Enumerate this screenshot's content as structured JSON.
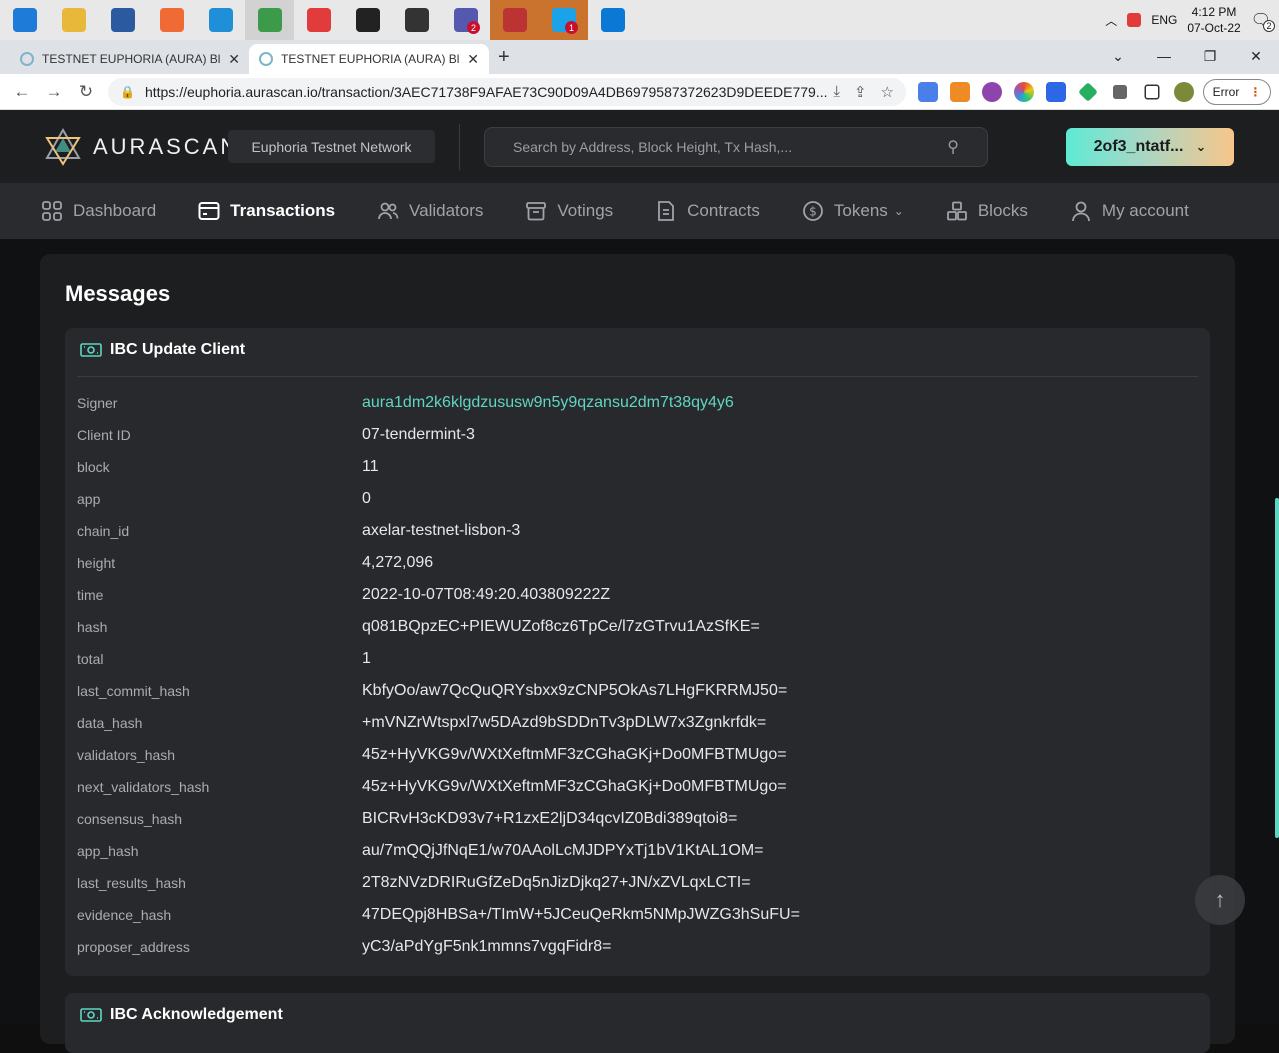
{
  "taskbar": {
    "apps": [
      {
        "name": "windows-start-icon",
        "color": "#1e7bd7"
      },
      {
        "name": "file-explorer-icon",
        "color": "#e8b83b"
      },
      {
        "name": "sql-tool-icon",
        "color": "#2b5aa0"
      },
      {
        "name": "postman-icon",
        "color": "#f06a35"
      },
      {
        "name": "edge-icon",
        "color": "#1f8fd8"
      },
      {
        "name": "chrome-icon",
        "color": "#3c9a4b"
      },
      {
        "name": "paw-icon",
        "color": "#e23b3b"
      },
      {
        "name": "gitkraken-icon",
        "color": "#222222"
      },
      {
        "name": "git-icon",
        "color": "#333333"
      },
      {
        "name": "teams-icon",
        "color": "#5558af",
        "badge": "2"
      },
      {
        "name": "paint-icon",
        "color": "#b33"
      },
      {
        "name": "skype-icon",
        "color": "#1aa3e8",
        "badge": "1"
      },
      {
        "name": "mail-icon",
        "color": "#0a78d4"
      }
    ],
    "tray": {
      "language": "ENG",
      "time": "4:12 PM",
      "date": "07-Oct-22",
      "notifications": "2"
    }
  },
  "browser": {
    "tabs": [
      {
        "title": "TESTNET EUPHORIA (AURA) Bloc"
      },
      {
        "title": "TESTNET EUPHORIA (AURA) Bloc"
      }
    ],
    "url": "https://euphoria.aurascan.io/transaction/3AEC71738F9AFAE73C90D09A4DB6979587372623D9DEEDE779...",
    "error_label": "Error"
  },
  "header": {
    "logo_text": "AURASCAN",
    "network": "Euphoria Testnet Network",
    "search_placeholder": "Search by Address, Block Height, Tx Hash,...",
    "wallet_label": "2of3_ntatf..."
  },
  "nav": [
    {
      "label": "Dashboard",
      "icon": "dashboard-icon"
    },
    {
      "label": "Transactions",
      "icon": "transactions-icon",
      "active": true
    },
    {
      "label": "Validators",
      "icon": "validators-icon"
    },
    {
      "label": "Votings",
      "icon": "votings-icon"
    },
    {
      "label": "Contracts",
      "icon": "contracts-icon"
    },
    {
      "label": "Tokens",
      "icon": "tokens-icon"
    },
    {
      "label": "Blocks",
      "icon": "blocks-icon"
    },
    {
      "label": "My account",
      "icon": "account-icon"
    }
  ],
  "messages": {
    "title": "Messages",
    "cards": [
      {
        "type": "IBC Update Client",
        "rows": [
          {
            "key": "Signer",
            "value": "aura1dm2k6klgdzususw9n5y9qzansu2dm7t38qy4y6",
            "link": true
          },
          {
            "key": "Client ID",
            "value": "07-tendermint-3"
          },
          {
            "key": "block",
            "value": "11"
          },
          {
            "key": "app",
            "value": "0"
          },
          {
            "key": "chain_id",
            "value": "axelar-testnet-lisbon-3"
          },
          {
            "key": "height",
            "value": "4,272,096"
          },
          {
            "key": "time",
            "value": "2022-10-07T08:49:20.403809222Z"
          },
          {
            "key": "hash",
            "value": "q081BQpzEC+PIEWUZof8cz6TpCe/l7zGTrvu1AzSfKE="
          },
          {
            "key": "total",
            "value": "1"
          },
          {
            "key": "last_commit_hash",
            "value": "KbfyOo/aw7QcQuQRYsbxx9zCNP5OkAs7LHgFKRRMJ50="
          },
          {
            "key": "data_hash",
            "value": "+mVNZrWtspxl7w5DAzd9bSDDnTv3pDLW7x3Zgnkrfdk="
          },
          {
            "key": "validators_hash",
            "value": "45z+HyVKG9v/WXtXeftmMF3zCGhaGKj+Do0MFBTMUgo="
          },
          {
            "key": "next_validators_hash",
            "value": "45z+HyVKG9v/WXtXeftmMF3zCGhaGKj+Do0MFBTMUgo="
          },
          {
            "key": "consensus_hash",
            "value": "BICRvH3cKD93v7+R1zxE2ljD34qcvIZ0Bdi389qtoi8="
          },
          {
            "key": "app_hash",
            "value": "au/7mQQjJfNqE1/w70AAolLcMJDPYxTj1bV1KtAL1OM="
          },
          {
            "key": "last_results_hash",
            "value": "2T8zNVzDRIRuGfZeDq5nJizDjkq27+JN/xZVLqxLCTI="
          },
          {
            "key": "evidence_hash",
            "value": "47DEQpj8HBSa+/TImW+5JCeuQeRkm5NMpJWZG3hSuFU="
          },
          {
            "key": "proposer_address",
            "value": "yC3/aPdYgF5nk1mmns7vgqFidr8="
          }
        ]
      },
      {
        "type": "IBC Acknowledgement"
      }
    ]
  },
  "colors": {
    "accent": "#5ed6c3",
    "panel": "#1d1e20",
    "card": "#28292c"
  }
}
